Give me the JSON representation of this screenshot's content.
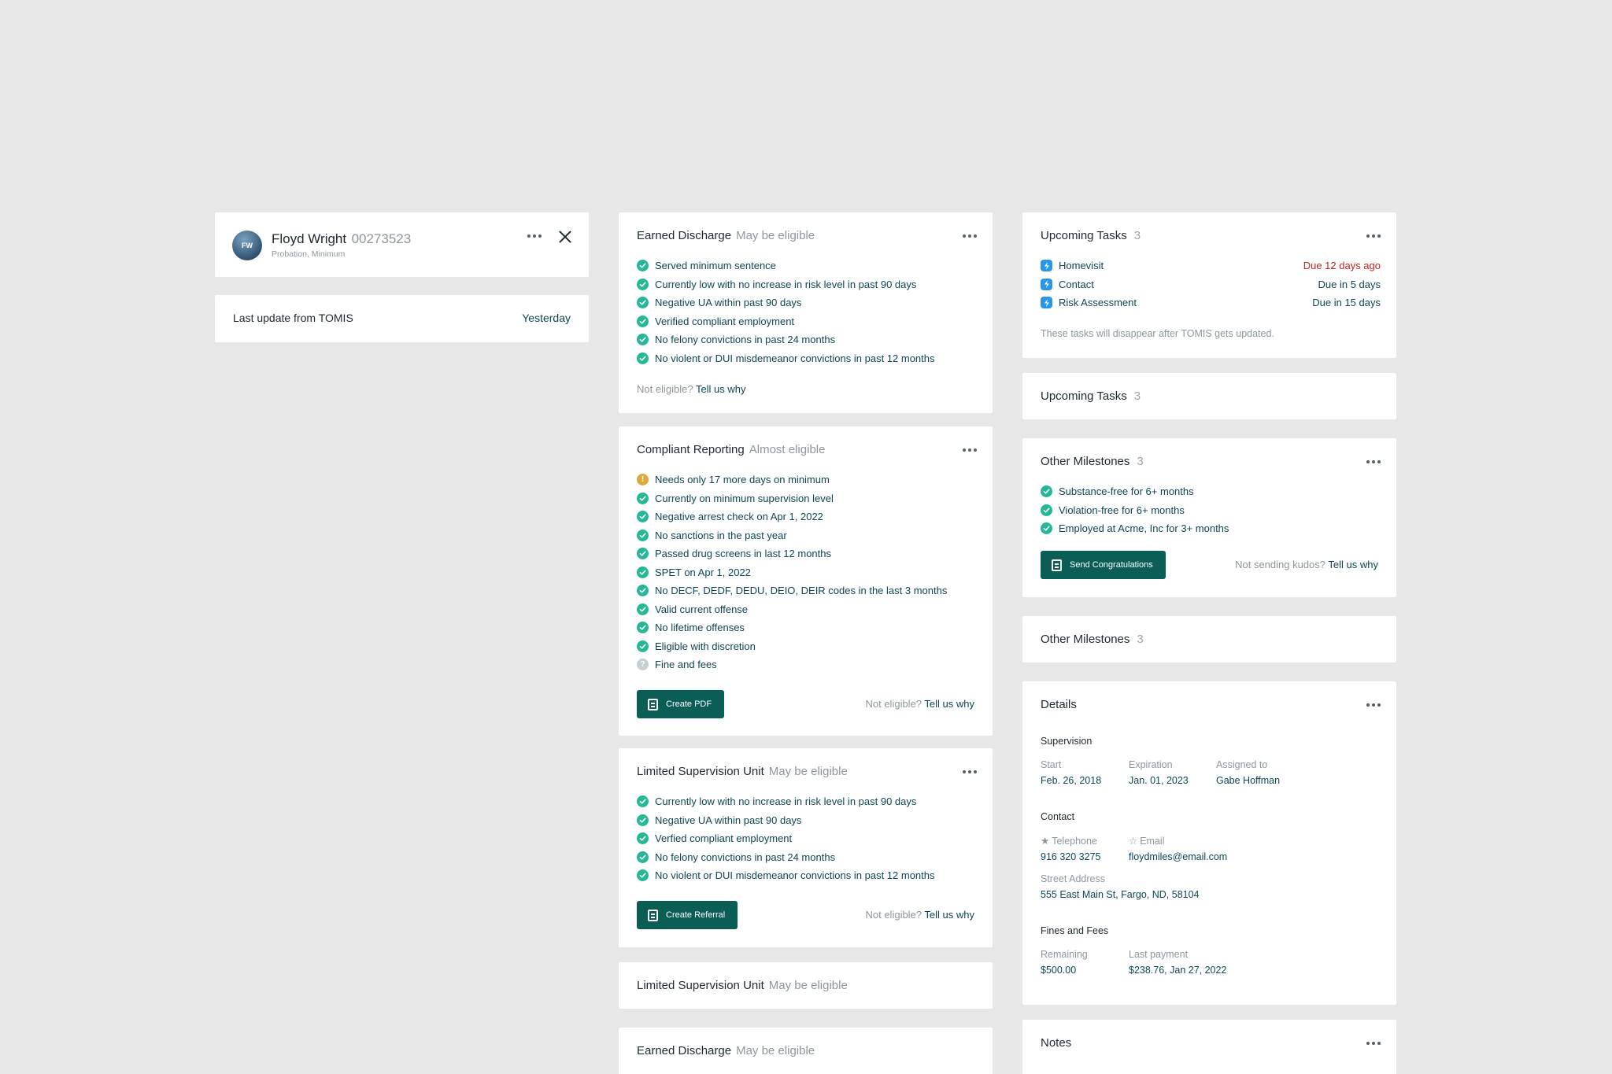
{
  "profile": {
    "initials": "FW",
    "name": "Floyd Wright",
    "id": "00273523",
    "subtitle": "Probation, Minimum"
  },
  "last_update": {
    "label": "Last update from TOMIS",
    "value": "Yesterday"
  },
  "earned_discharge": {
    "title": "Earned Discharge",
    "status": "May be eligible",
    "items": [
      "Served minimum sentence",
      "Currently low with no increase in risk level in past 90 days",
      "Negative UA within past 90 days",
      "Verified compliant employment",
      "No felony convictions in past 24 months",
      "No violent or DUI misdemeanor convictions in past 12 months"
    ],
    "not_eligible": "Not eligible?",
    "tell_us": "Tell us why"
  },
  "compliant_reporting": {
    "title": "Compliant Reporting",
    "status": "Almost eligible",
    "items": [
      {
        "state": "warn",
        "text": "Needs only 17 more days on minimum"
      },
      {
        "state": "ok",
        "text": "Currently on minimum supervision level"
      },
      {
        "state": "ok",
        "text": "Negative arrest check on Apr 1, 2022"
      },
      {
        "state": "ok",
        "text": "No sanctions in the past year"
      },
      {
        "state": "ok",
        "text": "Passed drug screens in last 12 months"
      },
      {
        "state": "ok",
        "text": "SPET on Apr 1, 2022"
      },
      {
        "state": "ok",
        "text": "No DECF, DEDF, DEDU, DEIO, DEIR codes in the last 3 months"
      },
      {
        "state": "ok",
        "text": "Valid current offense"
      },
      {
        "state": "ok",
        "text": "No lifetime offenses"
      },
      {
        "state": "ok",
        "text": "Eligible with discretion"
      },
      {
        "state": "unknown",
        "text": "Fine and fees"
      }
    ],
    "button": "Create PDF",
    "not_eligible": "Not eligible?",
    "tell_us": "Tell us why"
  },
  "limited_supervision": {
    "title": "Limited Supervision Unit",
    "status": "May be eligible",
    "items": [
      "Currently low with no increase in risk level in past 90 days",
      "Negative UA within past 90 days",
      "Verfied compliant employment",
      "No felony convictions in past 24 months",
      "No violent or DUI misdemeanor convictions in past 12 months"
    ],
    "button": "Create Referral",
    "not_eligible": "Not eligible?",
    "tell_us": "Tell us why"
  },
  "limited_supervision_collapsed": {
    "title": "Limited Supervision Unit",
    "status": "May be eligible"
  },
  "earned_discharge_collapsed": {
    "title": "Earned Discharge",
    "status": "May be eligible"
  },
  "upcoming_tasks": {
    "title": "Upcoming Tasks",
    "count": "3",
    "tasks": [
      {
        "name": "Homevisit",
        "due": "Due 12 days ago",
        "overdue": true
      },
      {
        "name": "Contact",
        "due": "Due in 5 days",
        "overdue": false
      },
      {
        "name": "Risk Assessment",
        "due": "Due in 15 days",
        "overdue": false
      }
    ],
    "note": "These tasks will disappear after TOMIS gets updated."
  },
  "upcoming_tasks_collapsed": {
    "title": "Upcoming Tasks",
    "count": "3"
  },
  "other_milestones": {
    "title": "Other Milestones",
    "count": "3",
    "items": [
      "Substance-free for 6+ months",
      "Violation-free for 6+ months",
      "Employed at Acme, Inc for 3+ months"
    ],
    "button": "Send Congratulations",
    "not_sending": "Not sending kudos?",
    "tell_us": "Tell us why"
  },
  "other_milestones_collapsed": {
    "title": "Other Milestones",
    "count": "3"
  },
  "details": {
    "title": "Details",
    "supervision": {
      "label": "Supervision",
      "start_label": "Start",
      "start": "Feb. 26, 2018",
      "expiration_label": "Expiration",
      "expiration": "Jan. 01, 2023",
      "assigned_label": "Assigned to",
      "assigned": "Gabe Hoffman"
    },
    "contact": {
      "label": "Contact",
      "telephone_label": "Telephone",
      "telephone": "916 320 3275",
      "email_label": "Email",
      "email": "floydmiles@email.com",
      "address_label": "Street Address",
      "address": "555 East Main St, Fargo, ND, 58104"
    },
    "fines": {
      "label": "Fines and Fees",
      "remaining_label": "Remaining",
      "remaining": "$500.00",
      "last_payment_label": "Last payment",
      "last_payment": "$238.76, Jan 27, 2022"
    }
  },
  "notes": {
    "title": "Notes"
  },
  "colors": {
    "background": "#e7e7e7",
    "accent": "#0b5e56",
    "check": "#25b894",
    "warning": "#e0a93f",
    "task": "#2996e8",
    "overdue": "#c0261d"
  }
}
